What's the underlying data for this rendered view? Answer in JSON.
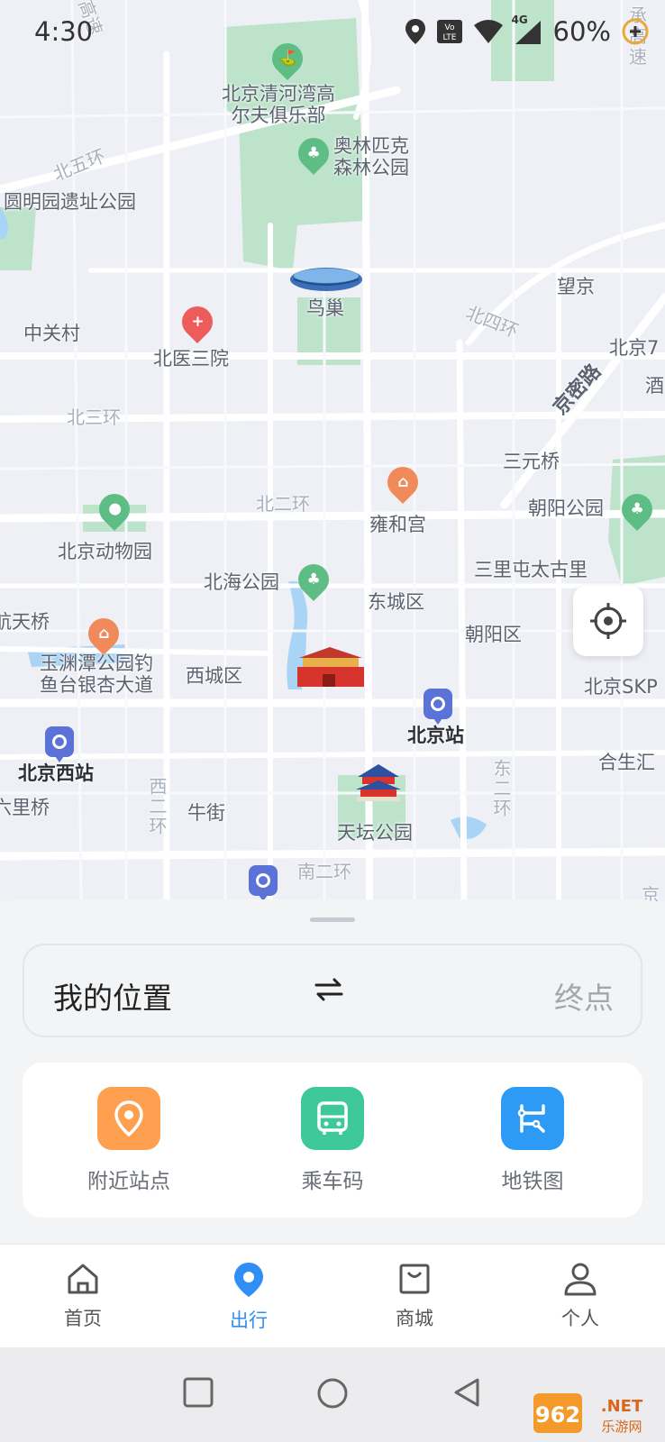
{
  "status_bar": {
    "time": "4:30",
    "battery": "60%",
    "network": "4G",
    "volte": "VoLTE",
    "icons": [
      "location-icon",
      "volte-icon",
      "wifi-icon",
      "signal-icon",
      "battery-saver-icon"
    ]
  },
  "map": {
    "labels": {
      "golf": "北京清河湾高\n尔夫俱乐部",
      "olympic_park": "奥林匹克\n森林公园",
      "yuanmingyuan": "圆明园遗址公园",
      "north_5th_ring": "北五环",
      "birds_nest": "鸟巢",
      "wangjing": "望京",
      "zhongguancun": "中关村",
      "beiyi_hospital": "北医三院",
      "north_4th_ring": "北四环",
      "beijing_7": "北京7",
      "jingmi_road": "京密路",
      "jiu": "酒",
      "north_3rd_ring": "北三环",
      "sanyuanqiao": "三元桥",
      "north_2nd_ring": "北二环",
      "yonghegong": "雍和宫",
      "chaoyang_park": "朝阳公园",
      "beijing_zoo": "北京动物园",
      "sanlitun": "三里屯太古里",
      "beihai_park": "北海公园",
      "dongcheng": "东城区",
      "tianqiao": "航天桥",
      "yuyuantan": "玉渊潭公园钓\n鱼台银杏大道",
      "xicheng": "西城区",
      "chaoyang": "朝阳区",
      "beijing_skp": "北京SKP",
      "beijing_station": "北京站",
      "beijing_west": "北京西站",
      "hesheng": "合生汇",
      "west_2nd_ring": "西二环",
      "east_2nd_ring": "东二环",
      "liuliqiao": "六里桥",
      "niujie": "牛街",
      "temple_of_heaven": "天坛公园",
      "south_2nd_ring": "南二环",
      "chengde_hw": "承\n高\n速",
      "highway_top": "高速",
      "jing_bottom": "京"
    }
  },
  "route": {
    "from": "我的位置",
    "to": "终点"
  },
  "quick_actions": [
    {
      "label": "附近站点",
      "icon": "location-pin-icon",
      "color": "#ff9f50"
    },
    {
      "label": "乘车码",
      "icon": "bus-icon",
      "color": "#3fc99a"
    },
    {
      "label": "地铁图",
      "icon": "subway-map-icon",
      "color": "#2d9bf5"
    }
  ],
  "tabs": [
    {
      "label": "首页",
      "icon": "home-icon"
    },
    {
      "label": "出行",
      "icon": "travel-pin-icon",
      "active": true
    },
    {
      "label": "商城",
      "icon": "shop-bag-icon"
    },
    {
      "label": "个人",
      "icon": "person-icon"
    }
  ],
  "colors": {
    "accent": "#2f8ff5",
    "park": "#bde3cb",
    "map_bg": "#eef0f6"
  },
  "watermark": "962.NET 乐游网"
}
